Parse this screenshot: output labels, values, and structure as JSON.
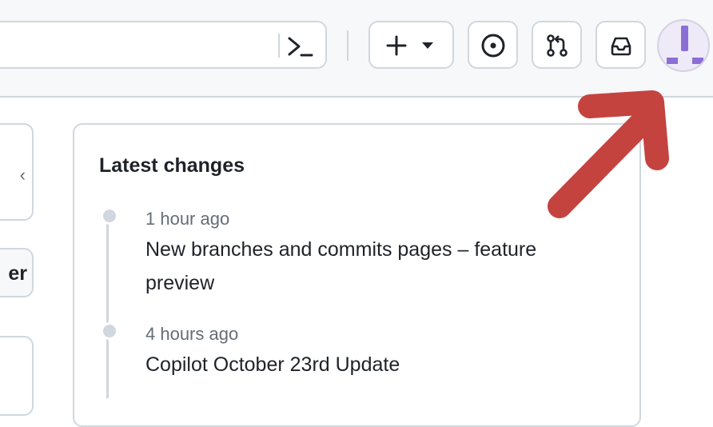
{
  "header": {
    "command_palette_icon": "terminal-prompt-icon",
    "create_icon": "plus-icon",
    "create_menu_icon": "triangle-down-icon",
    "issues_icon": "issue-opened-icon",
    "pull_requests_icon": "git-pull-request-icon",
    "inbox_icon": "inbox-icon",
    "avatar_icon": "identicon-avatar",
    "accent_color": "#8b6fd6"
  },
  "sidebar": {
    "button_partial_label": "er"
  },
  "latest_changes": {
    "title": "Latest changes",
    "items": [
      {
        "time": "1 hour ago",
        "title": "New branches and commits pages – feature preview"
      },
      {
        "time": "4 hours ago",
        "title": "Copilot October 23rd Update"
      }
    ]
  },
  "annotation": {
    "arrow_color": "#c4433f"
  }
}
